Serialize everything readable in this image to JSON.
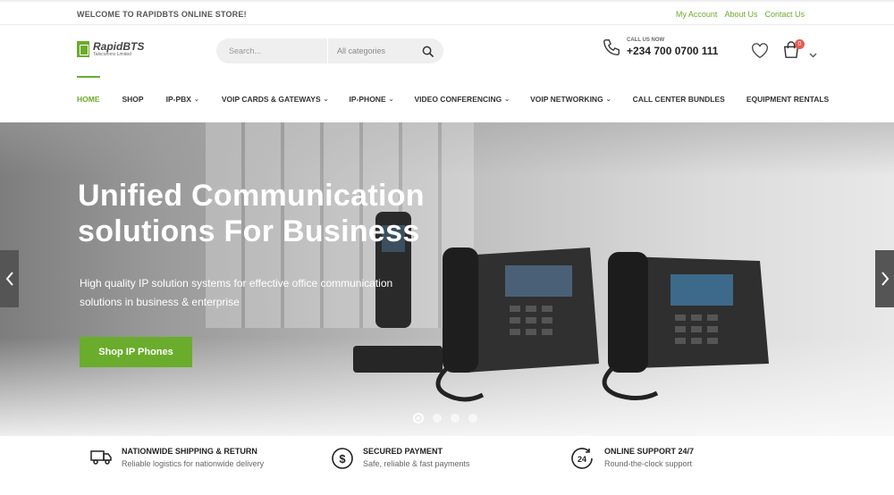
{
  "topbar": {
    "welcome": "WELCOME TO RAPIDBTS ONLINE STORE!",
    "links": [
      "My Account",
      "About Us",
      "Contact Us"
    ]
  },
  "header": {
    "logo_name": "RapidBTS",
    "logo_sub": "Telecomms Limited",
    "search_placeholder": "Search...",
    "search_category": "All categories",
    "call_label": "CALL US NOW",
    "phone": "+234 700 0700 111",
    "cart_count": "0"
  },
  "nav": {
    "items": [
      {
        "label": "HOME",
        "dropdown": false,
        "active": true
      },
      {
        "label": "SHOP",
        "dropdown": false
      },
      {
        "label": "IP-PBX",
        "dropdown": true
      },
      {
        "label": "VOIP CARDS & GATEWAYS",
        "dropdown": true
      },
      {
        "label": "IP-PHONE",
        "dropdown": true
      },
      {
        "label": "VIDEO CONFERENCING",
        "dropdown": true
      },
      {
        "label": "VOIP NETWORKING",
        "dropdown": true
      },
      {
        "label": "CALL CENTER BUNDLES",
        "dropdown": false
      },
      {
        "label": "EQUIPMENT RENTALS",
        "dropdown": false
      }
    ]
  },
  "hero": {
    "title_line1": "Unified Communication",
    "title_line2": "solutions For Business",
    "subtitle_line1": "High quality IP solution systems for effective office communication",
    "subtitle_line2": "solutions in business & enterprise",
    "cta": "Shop IP Phones",
    "slide_count": 4,
    "active_slide": 1
  },
  "features": [
    {
      "icon": "truck-icon",
      "title": "NATIONWIDE SHIPPING & RETURN",
      "desc": "Reliable logistics for nationwide delivery"
    },
    {
      "icon": "dollar-icon",
      "title": "SECURED PAYMENT",
      "desc": "Safe, reliable & fast payments"
    },
    {
      "icon": "support-24-icon",
      "title": "ONLINE SUPPORT 24/7",
      "desc": "Round-the-clock support"
    }
  ],
  "colors": {
    "accent": "#6aac2c",
    "badge": "#e85a4f"
  }
}
